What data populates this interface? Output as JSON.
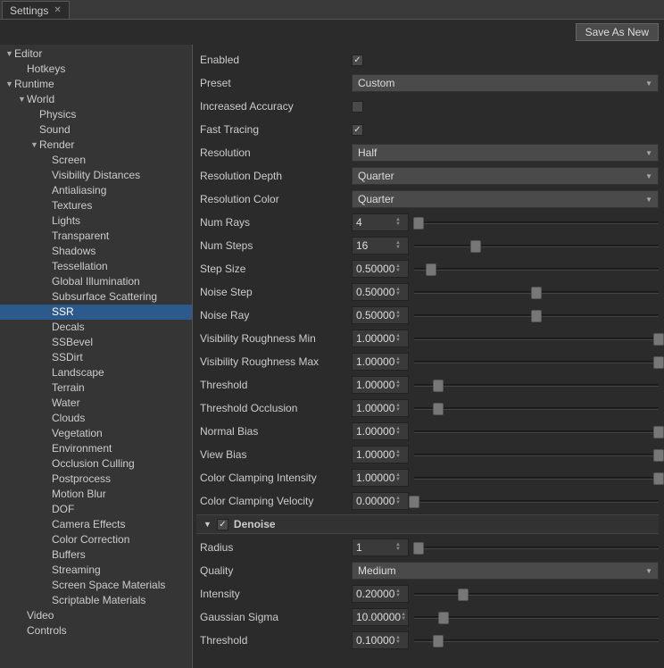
{
  "tab": {
    "title": "Settings"
  },
  "topbar": {
    "save_as_new": "Save As New"
  },
  "sidebar": {
    "items": [
      {
        "label": "Editor",
        "depth": 0,
        "arrow": "▼"
      },
      {
        "label": "Hotkeys",
        "depth": 1,
        "arrow": ""
      },
      {
        "label": "Runtime",
        "depth": 0,
        "arrow": "▼"
      },
      {
        "label": "World",
        "depth": 1,
        "arrow": "▼"
      },
      {
        "label": "Physics",
        "depth": 2,
        "arrow": ""
      },
      {
        "label": "Sound",
        "depth": 2,
        "arrow": ""
      },
      {
        "label": "Render",
        "depth": 2,
        "arrow": "▼"
      },
      {
        "label": "Screen",
        "depth": 3,
        "arrow": ""
      },
      {
        "label": "Visibility Distances",
        "depth": 3,
        "arrow": ""
      },
      {
        "label": "Antialiasing",
        "depth": 3,
        "arrow": ""
      },
      {
        "label": "Textures",
        "depth": 3,
        "arrow": ""
      },
      {
        "label": "Lights",
        "depth": 3,
        "arrow": ""
      },
      {
        "label": "Transparent",
        "depth": 3,
        "arrow": ""
      },
      {
        "label": "Shadows",
        "depth": 3,
        "arrow": ""
      },
      {
        "label": "Tessellation",
        "depth": 3,
        "arrow": ""
      },
      {
        "label": "Global Illumination",
        "depth": 3,
        "arrow": ""
      },
      {
        "label": "Subsurface Scattering",
        "depth": 3,
        "arrow": ""
      },
      {
        "label": "SSR",
        "depth": 3,
        "arrow": "",
        "selected": true
      },
      {
        "label": "Decals",
        "depth": 3,
        "arrow": ""
      },
      {
        "label": "SSBevel",
        "depth": 3,
        "arrow": ""
      },
      {
        "label": "SSDirt",
        "depth": 3,
        "arrow": ""
      },
      {
        "label": "Landscape",
        "depth": 3,
        "arrow": ""
      },
      {
        "label": "Terrain",
        "depth": 3,
        "arrow": ""
      },
      {
        "label": "Water",
        "depth": 3,
        "arrow": ""
      },
      {
        "label": "Clouds",
        "depth": 3,
        "arrow": ""
      },
      {
        "label": "Vegetation",
        "depth": 3,
        "arrow": ""
      },
      {
        "label": "Environment",
        "depth": 3,
        "arrow": ""
      },
      {
        "label": "Occlusion Culling",
        "depth": 3,
        "arrow": ""
      },
      {
        "label": "Postprocess",
        "depth": 3,
        "arrow": ""
      },
      {
        "label": "Motion Blur",
        "depth": 3,
        "arrow": ""
      },
      {
        "label": "DOF",
        "depth": 3,
        "arrow": ""
      },
      {
        "label": "Camera Effects",
        "depth": 3,
        "arrow": ""
      },
      {
        "label": "Color Correction",
        "depth": 3,
        "arrow": ""
      },
      {
        "label": "Buffers",
        "depth": 3,
        "arrow": ""
      },
      {
        "label": "Streaming",
        "depth": 3,
        "arrow": ""
      },
      {
        "label": "Screen Space Materials",
        "depth": 3,
        "arrow": ""
      },
      {
        "label": "Scriptable Materials",
        "depth": 3,
        "arrow": ""
      },
      {
        "label": "Video",
        "depth": 1,
        "arrow": ""
      },
      {
        "label": "Controls",
        "depth": 1,
        "arrow": ""
      }
    ]
  },
  "settings": {
    "enabled": {
      "label": "Enabled",
      "checked": true
    },
    "preset": {
      "label": "Preset",
      "value": "Custom"
    },
    "increased_accuracy": {
      "label": "Increased Accuracy",
      "checked": false
    },
    "fast_tracing": {
      "label": "Fast Tracing",
      "checked": true
    },
    "resolution": {
      "label": "Resolution",
      "value": "Half"
    },
    "resolution_depth": {
      "label": "Resolution Depth",
      "value": "Quarter"
    },
    "resolution_color": {
      "label": "Resolution Color",
      "value": "Quarter"
    },
    "num_rays": {
      "label": "Num Rays",
      "value": "4",
      "slider": 2
    },
    "num_steps": {
      "label": "Num Steps",
      "value": "16",
      "slider": 25
    },
    "step_size": {
      "label": "Step Size",
      "value": "0.50000",
      "slider": 7
    },
    "noise_step": {
      "label": "Noise Step",
      "value": "0.50000",
      "slider": 50
    },
    "noise_ray": {
      "label": "Noise Ray",
      "value": "0.50000",
      "slider": 50
    },
    "vis_rough_min": {
      "label": "Visibility Roughness Min",
      "value": "1.00000",
      "slider": 100
    },
    "vis_rough_max": {
      "label": "Visibility Roughness Max",
      "value": "1.00000",
      "slider": 100
    },
    "threshold": {
      "label": "Threshold",
      "value": "1.00000",
      "slider": 10
    },
    "threshold_occlusion": {
      "label": "Threshold Occlusion",
      "value": "1.00000",
      "slider": 10
    },
    "normal_bias": {
      "label": "Normal Bias",
      "value": "1.00000",
      "slider": 100
    },
    "view_bias": {
      "label": "View Bias",
      "value": "1.00000",
      "slider": 100
    },
    "color_clamp_intensity": {
      "label": "Color Clamping Intensity",
      "value": "1.00000",
      "slider": 100
    },
    "color_clamp_velocity": {
      "label": "Color Clamping Velocity",
      "value": "0.00000",
      "slider": 0
    }
  },
  "denoise": {
    "title": "Denoise",
    "checked": true,
    "radius": {
      "label": "Radius",
      "value": "1",
      "slider": 2
    },
    "quality": {
      "label": "Quality",
      "value": "Medium"
    },
    "intensity": {
      "label": "Intensity",
      "value": "0.20000",
      "slider": 20
    },
    "gaussian_sigma": {
      "label": "Gaussian Sigma",
      "value": "10.00000",
      "slider": 12
    },
    "threshold": {
      "label": "Threshold",
      "value": "0.10000",
      "slider": 10
    }
  }
}
